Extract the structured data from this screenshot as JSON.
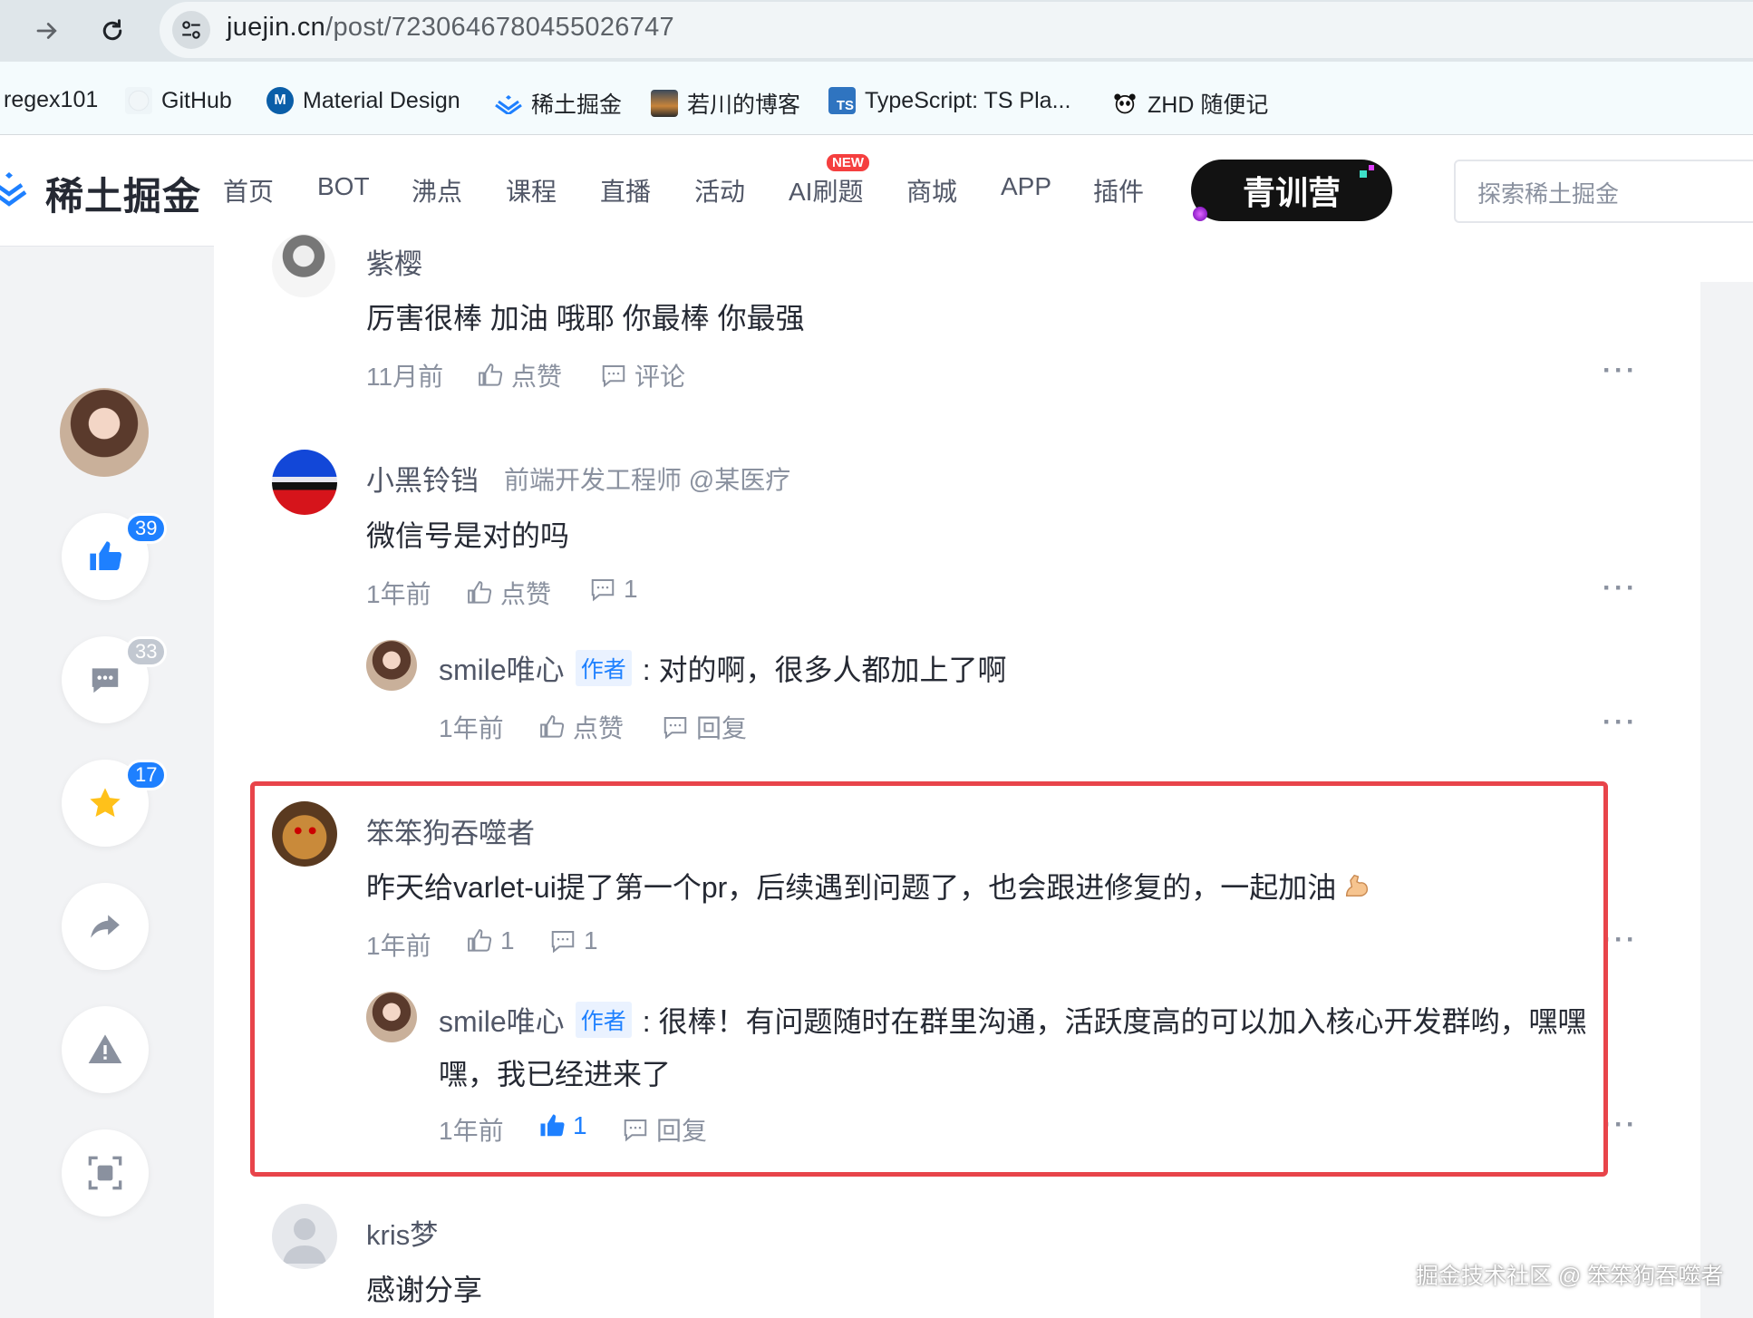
{
  "browser": {
    "url_host": "juejin.cn",
    "url_path": "/post/7230646780455026747",
    "bookmarks": [
      {
        "label": "regex101",
        "icon": "none"
      },
      {
        "label": "GitHub",
        "icon": "github-icon"
      },
      {
        "label": "Material Design",
        "icon": "material-design-icon"
      },
      {
        "label": "稀土掘金",
        "icon": "juejin-logo-icon"
      },
      {
        "label": "若川的博客",
        "icon": "landscape-thumbnail-icon"
      },
      {
        "label": "TypeScript: TS Pla...",
        "icon": "typescript-icon"
      },
      {
        "label": "ZHD 随便记",
        "icon": "panda-icon"
      }
    ]
  },
  "header": {
    "logo": "稀土掘金",
    "menu": [
      "首页",
      "BOT",
      "沸点",
      "课程",
      "直播",
      "活动",
      "AI刷题",
      "商城",
      "APP",
      "插件"
    ],
    "new_badge": "NEW",
    "camp": "青训营",
    "search_placeholder": "探索稀土掘金"
  },
  "sidebar": {
    "like_count": "39",
    "comment_count": "33",
    "collect_count": "17"
  },
  "comments": [
    {
      "name": "紫樱",
      "text": "厉害很棒 加油 哦耶 你最棒 你最强",
      "time": "11月前",
      "like": "点赞",
      "reply": "评论"
    },
    {
      "name": "小黑铃铛",
      "title": "前端开发工程师 @某医疗",
      "text": "微信号是对的吗",
      "time": "1年前",
      "like": "点赞",
      "reply": "1",
      "sub": {
        "name": "smile唯心",
        "tag": "作者",
        "text": ": 对的啊，很多人都加上了啊",
        "time": "1年前",
        "like": "点赞",
        "reply": "回复"
      }
    },
    {
      "name": "笨笨狗吞噬者",
      "text": "昨天给varlet-ui提了第一个pr，后续遇到问题了，也会跟进修复的，一起加油",
      "time": "1年前",
      "like": "1",
      "reply": "1",
      "sub": {
        "name": "smile唯心",
        "tag": "作者",
        "text_line1": ": 很棒！有问题随时在群里沟通，活跃度高的可以加入核心开发群哟，嘿嘿",
        "text_line2": "嘿，我已经进来了",
        "time": "1年前",
        "like": "1",
        "reply": "回复"
      }
    },
    {
      "name": "kris梦",
      "text": "感谢分享"
    }
  ],
  "watermark": "掘金技术社区 @ 笨笨狗吞噬者",
  "colors": {
    "accent": "#1e80ff",
    "highlight_border": "#e8444a",
    "muted": "#8a919f"
  }
}
